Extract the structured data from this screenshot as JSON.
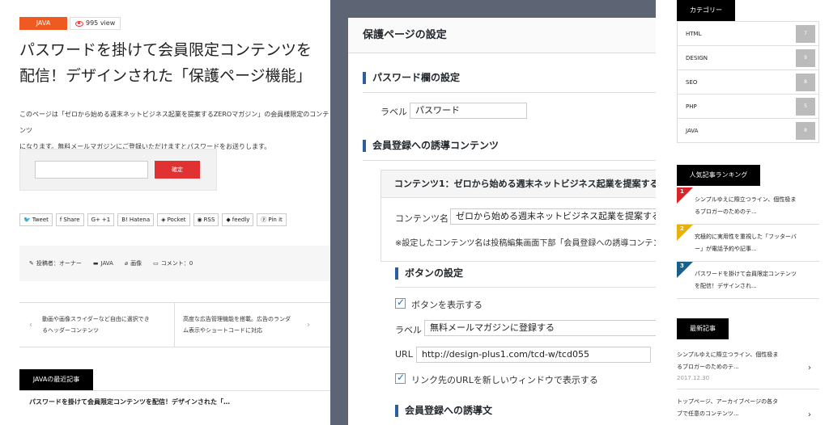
{
  "article": {
    "category": "JAVA",
    "views": "995 view",
    "title": "パスワードを掛けて会員限定コンテンツを\n配信！デザインされた「保護ページ機能」",
    "intro": "このページは「ゼロから始める週末ネットビジネス起業を提案するZEROマガジン」の会員様限定のコンテンツ\nになります。無料メールマガジンにご登録いただけますとパスワードをお送りします。",
    "submit_label": "確定",
    "share": [
      {
        "icon": "twitter-icon",
        "glyph": "🐦",
        "label": "Tweet"
      },
      {
        "icon": "facebook-icon",
        "glyph": "f",
        "label": "Share"
      },
      {
        "icon": "google-plus-icon",
        "glyph": "G+",
        "label": "+1"
      },
      {
        "icon": "hatena-icon",
        "glyph": "B!",
        "label": "Hatena"
      },
      {
        "icon": "pocket-icon",
        "glyph": "◈",
        "label": "Pocket"
      },
      {
        "icon": "rss-icon",
        "glyph": "◉",
        "label": "RSS"
      },
      {
        "icon": "feedly-icon",
        "glyph": "◆",
        "label": "feedly"
      },
      {
        "icon": "pinterest-icon",
        "glyph": "ⓟ",
        "label": "Pin it"
      }
    ],
    "meta": {
      "author": "投稿者：オーナー",
      "category": "JAVA",
      "tag": "画像",
      "comments": "コメント：0"
    },
    "prev_post": "動画や画像スライダーなど自由に選択でき\nるヘッダーコンテンツ",
    "next_post": "高度な広告管理機能を搭載。広告のランダ\nム表示やショートコードに対応",
    "recent_heading": "JAVAの最近記事",
    "recent_item": "パスワードを掛けて会員限定コンテンツを配信！デザインされた「…"
  },
  "admin": {
    "title": "保護ページの設定",
    "pw_section": "パスワード欄の設定",
    "label_text": "ラベル",
    "pw_label_value": "パスワード",
    "guide_section": "会員登録への誘導コンテンツ",
    "content_head": "コンテンツ1：ゼロから始める週末ネットビジネス起業を提案するZ",
    "content_name_label": "コンテンツ名",
    "content_name_value": "ゼロから始める週末ネットビジネス起業を提案するZ",
    "content_note": "※設定したコンテンツ名は投稿編集画面下部「会員登録への誘導コンテン",
    "button_section": "ボタンの設定",
    "show_button": "ボタンを表示する",
    "button_label_value": "無料メールマガジンに登録する",
    "url_label": "URL",
    "url_value": "http://design-plus1.com/tcd-w/tcd055",
    "new_window": "リンク先のURLを新しいウィンドウで表示する",
    "guide_text_section": "会員登録への誘導文"
  },
  "sidebar": {
    "category_heading": "カテゴリー",
    "categories": [
      {
        "name": "HTML",
        "count": "7"
      },
      {
        "name": "DESIGN",
        "count": "9"
      },
      {
        "name": "SEO",
        "count": "8"
      },
      {
        "name": "PHP",
        "count": "5"
      },
      {
        "name": "JAVA",
        "count": "8"
      }
    ],
    "ranking_heading": "人気記事ランキング",
    "ranking": [
      {
        "num": "1",
        "color": "#d9252a",
        "text": "シンプルゆえに際立つライン、個性极ま\nるブロガーのためのテ..."
      },
      {
        "num": "2",
        "color": "#e8b10c",
        "text": "究極的に実用性を重視した「フッターバ\nー」が電話予約や記事..."
      },
      {
        "num": "3",
        "color": "#1a5f8a",
        "text": "パスワードを掛けて会員限定コンテンツ\nを配信！デザインされ..."
      }
    ],
    "news_heading": "最新記事",
    "news": [
      {
        "text": "シンプルゆえに際立つライン、個性极ま\nるブロガーのためのテ...",
        "date": "2017.12.30"
      },
      {
        "text": "トップページ、アーカイブページの各タ\nブで任意のコンテンツ...",
        "date": ""
      }
    ]
  }
}
